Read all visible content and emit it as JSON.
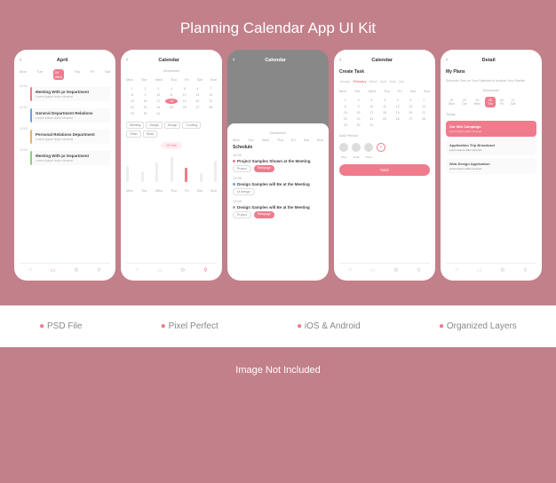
{
  "banner": {
    "title": "Planning Calendar App UI Kit"
  },
  "features": [
    "PSD File",
    "Pixel Perfect",
    "iOS & Android",
    "Organized Layers"
  ],
  "footer": "Image Not Included",
  "colors": {
    "accent": "#ef7b8c",
    "bg": "#c2808a"
  },
  "screens": {
    "s1": {
      "title": "April",
      "days": [
        "Mon",
        "Tue",
        "Wed",
        "Thu",
        "Fri",
        "Sat"
      ],
      "selected_day": "24",
      "selected_day_label": "Wed",
      "events": [
        {
          "time": "10:00",
          "title": "Meeting With pr Department",
          "desc": "Lorem ipsum dolor sit amet",
          "color": "#ef7b8c"
        },
        {
          "time": "11:00",
          "title": "General Department Relations",
          "desc": "Lorem ipsum dolor sit amet",
          "color": "#6aa3e8"
        },
        {
          "time": "12:00",
          "title": "Personal Relations Department",
          "desc": "Lorem ipsum dolor sit amet",
          "color": "#e8b36a"
        },
        {
          "time": "13:00",
          "title": "Meeting With pr Department",
          "desc": "Lorem ipsum dolor sit amet",
          "color": "#8ad17b"
        }
      ]
    },
    "s2": {
      "title": "Calendar",
      "month": "December",
      "weekdays": [
        "Mon",
        "Tue",
        "Wed",
        "Thu",
        "Fri",
        "Sat",
        "Sun"
      ],
      "active_date": 18,
      "categories": [
        "Meeting",
        "Hangs",
        "Design",
        "Cooking",
        "Other",
        "Read"
      ],
      "tab_label": "20 Task",
      "bar_days": [
        "Mon",
        "Tue",
        "Wed",
        "Thu",
        "Fri",
        "Sat",
        "Sun"
      ]
    },
    "s3": {
      "title": "Calendar",
      "month": "December",
      "weekdays": [
        "Mon",
        "Tue",
        "Wed",
        "Thu",
        "Fri",
        "Sat",
        "Sun"
      ],
      "schedule_label": "Schedule",
      "items": [
        {
          "time": "10:00",
          "title": "Project Samples Shown at the Meeting",
          "chips": [
            "Project",
            "Webpage"
          ],
          "dot": "#ef7b8c"
        },
        {
          "time": "12:00",
          "title": "Design Samples will Be at the Meeting",
          "chips": [
            "Ui design"
          ],
          "dot": "#6aa3e8"
        },
        {
          "time": "13:30",
          "title": "Design Samples will Be at the Meeting",
          "chips": [
            "Project",
            "Webpage"
          ],
          "dot": "#aaa"
        }
      ]
    },
    "s4": {
      "title": "Calendar",
      "heading": "Create Task",
      "months": [
        "January",
        "February",
        "March",
        "April",
        "June",
        "July"
      ],
      "active_month": "February",
      "weekdays": [
        "Mon",
        "Tue",
        "Wed",
        "Thu",
        "Fri",
        "Sat",
        "Sun"
      ],
      "add_person_label": "Add Person",
      "people": [
        "Mike",
        "Judith",
        "Tiana"
      ],
      "button": "Next"
    },
    "s5": {
      "title": "Detail",
      "heading": "My Plans",
      "sub": "Schedule Time on Your Calendar to Analyze Your Results",
      "month": "December",
      "dates": [
        {
          "n": "22",
          "d": "Mon"
        },
        {
          "n": "23",
          "d": "Tue"
        },
        {
          "n": "24",
          "d": "Wed"
        },
        {
          "n": "25",
          "d": "Thu"
        },
        {
          "n": "26",
          "d": "Fri"
        },
        {
          "n": "27",
          "d": "Sat"
        }
      ],
      "active_idx": 3,
      "today_label": "Today",
      "plans": [
        {
          "title": "Car Win Campaign",
          "desc": "Lorem ipsum dolor sit amet",
          "variant": "pink"
        },
        {
          "title": "Application Trip Broadcast",
          "desc": "Lorem ipsum dolor sit amet",
          "variant": "outline"
        },
        {
          "title": "Web Design Application",
          "desc": "Lorem ipsum dolor sit amet",
          "variant": "outline"
        }
      ]
    }
  },
  "chart_data": {
    "type": "bar",
    "categories": [
      "Mon",
      "Tue",
      "Wed",
      "Thu",
      "Fri",
      "Sat",
      "Sun"
    ],
    "values": [
      18,
      12,
      22,
      28,
      16,
      10,
      24
    ],
    "active_index": 4,
    "title": "20 Task",
    "ylim": [
      0,
      30
    ]
  }
}
